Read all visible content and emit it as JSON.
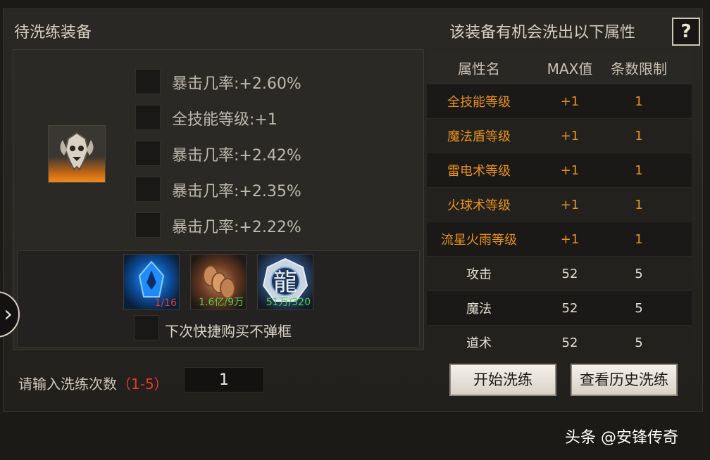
{
  "header": {
    "left_title": "待洗练装备",
    "right_title": "该装备有机会洗出以下属性",
    "help_label": "?"
  },
  "equipment": {
    "icon": "demon-mask-helmet-icon",
    "attributes": [
      "暴击几率:+2.60%",
      "全技能等级:+1",
      "暴击几率:+2.42%",
      "暴击几率:+2.35%",
      "暴击几率:+2.22%"
    ]
  },
  "materials": [
    {
      "icon": "blue-crystal-icon",
      "count": "1/16",
      "count_color": "#e03a2a"
    },
    {
      "icon": "gold-coins-icon",
      "count": "1.6亿/9万",
      "count_color": "#4ed24e"
    },
    {
      "icon": "dragon-medal-icon",
      "count": "51万/320",
      "count_color": "#4ed24e",
      "glyph": "龍"
    }
  ],
  "quick_buy_label": "下次快捷购买不弹框",
  "table": {
    "headers": [
      "属性名",
      "MAX值",
      "条数限制"
    ],
    "rows": [
      {
        "name": "全技能等级",
        "max": "+1",
        "limit": "1",
        "highlight": true
      },
      {
        "name": "魔法盾等级",
        "max": "+1",
        "limit": "1",
        "highlight": true
      },
      {
        "name": "雷电术等级",
        "max": "+1",
        "limit": "1",
        "highlight": true
      },
      {
        "name": "火球术等级",
        "max": "+1",
        "limit": "1",
        "highlight": true
      },
      {
        "name": "流星火雨等级",
        "max": "+1",
        "limit": "1",
        "highlight": true
      },
      {
        "name": "攻击",
        "max": "52",
        "limit": "5",
        "highlight": false
      },
      {
        "name": "魔法",
        "max": "52",
        "limit": "5",
        "highlight": false
      },
      {
        "name": "道术",
        "max": "52",
        "limit": "5",
        "highlight": false
      }
    ]
  },
  "count_input": {
    "label": "请输入洗练次数",
    "range": "（1-5）",
    "value": "1"
  },
  "buttons": {
    "start": "开始洗练",
    "history": "查看历史洗练"
  },
  "nav_arrow": "›",
  "watermark": "头条 @安锋传奇",
  "colors": {
    "orange_attr": "#e8921e",
    "range_red": "#e53a2a"
  }
}
